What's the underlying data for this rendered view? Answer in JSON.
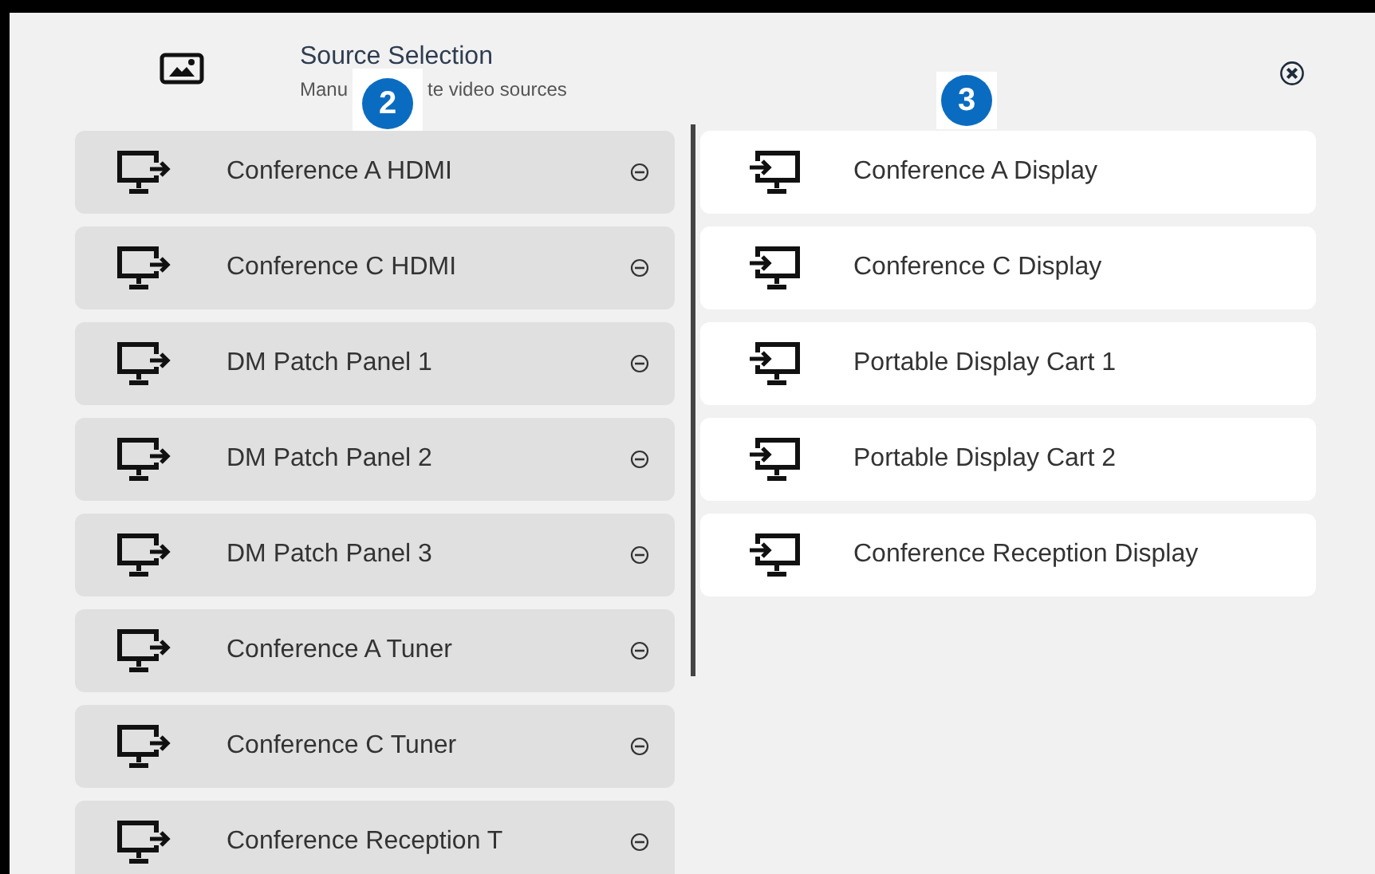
{
  "header": {
    "title": "Source Selection",
    "subtitle_parts": [
      "Manu",
      "te video sources"
    ]
  },
  "callouts": [
    {
      "label": "2"
    },
    {
      "label": "3"
    }
  ],
  "sources": [
    {
      "name": "Conference A HDMI"
    },
    {
      "name": "Conference C HDMI"
    },
    {
      "name": "DM Patch Panel 1"
    },
    {
      "name": "DM Patch Panel 2"
    },
    {
      "name": "DM Patch Panel 3"
    },
    {
      "name": "Conference A Tuner"
    },
    {
      "name": "Conference C Tuner"
    },
    {
      "name": "Conference Reception T"
    }
  ],
  "displays": [
    {
      "name": "Conference A Display"
    },
    {
      "name": "Conference C Display"
    },
    {
      "name": "Portable Display Cart 1"
    },
    {
      "name": "Portable Display Cart 2"
    },
    {
      "name": "Conference Reception Display"
    }
  ]
}
